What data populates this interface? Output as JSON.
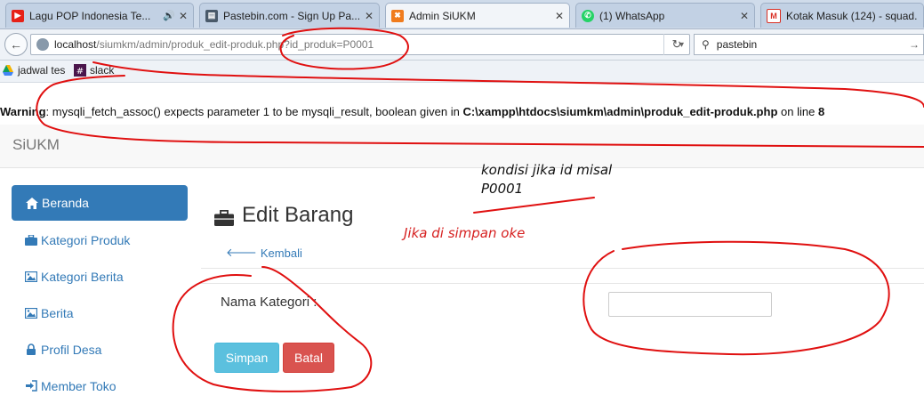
{
  "browser": {
    "tabs": [
      {
        "label": "Lagu POP Indonesia Te...",
        "favicon": "youtube-icon",
        "color": "#e62117"
      },
      {
        "label": "Pastebin.com - Sign Up Pa...",
        "favicon": "pastebin-icon",
        "color": "#4a5a6a"
      },
      {
        "label": "Admin SiUKM",
        "favicon": "xampp-icon",
        "color": "#f07c1e"
      },
      {
        "label": "(1) WhatsApp",
        "favicon": "whatsapp-icon",
        "color": "#25d366"
      },
      {
        "label": "Kotak Masuk (124) - squad...",
        "favicon": "gmail-icon",
        "color": "#d93025"
      }
    ],
    "url_host": "localhost",
    "url_path": "/siumkm/admin/produk_edit-produk.php?id_produk=P0001",
    "search_value": "pastebin",
    "bookmarks": [
      {
        "label": "jadwal tes",
        "icon": "drive-icon"
      },
      {
        "label": "slack",
        "icon": "slack-icon"
      }
    ]
  },
  "warning": {
    "label": "Warning",
    "message": ": mysqli_fetch_assoc() expects parameter 1 to be mysqli_result, boolean given in ",
    "path": "C:\\xampp\\htdocs\\siumkm\\admin\\produk_edit-produk.php",
    "line_text": " on line ",
    "line": "8"
  },
  "app": {
    "brand": "SiUKM",
    "accent": "#337ab7",
    "sidebar": [
      {
        "label": "Beranda",
        "icon": "home-icon",
        "active": true
      },
      {
        "label": "Kategori Produk",
        "icon": "briefcase-icon"
      },
      {
        "label": "Kategori Berita",
        "icon": "picture-icon"
      },
      {
        "label": "Berita",
        "icon": "picture-icon"
      },
      {
        "label": "Profil Desa",
        "icon": "lock-icon"
      },
      {
        "label": "Member Toko",
        "icon": "login-icon"
      }
    ],
    "page_title": "Edit Barang",
    "back_label": "Kembali",
    "form": {
      "label": "Nama Kategori :",
      "value": ""
    },
    "save_label": "Simpan",
    "cancel_label": "Batal"
  },
  "annotations": {
    "note1_line1": "kondisi jika id misal",
    "note1_line2": "P0001",
    "note2": "Jika di simpan oke"
  }
}
